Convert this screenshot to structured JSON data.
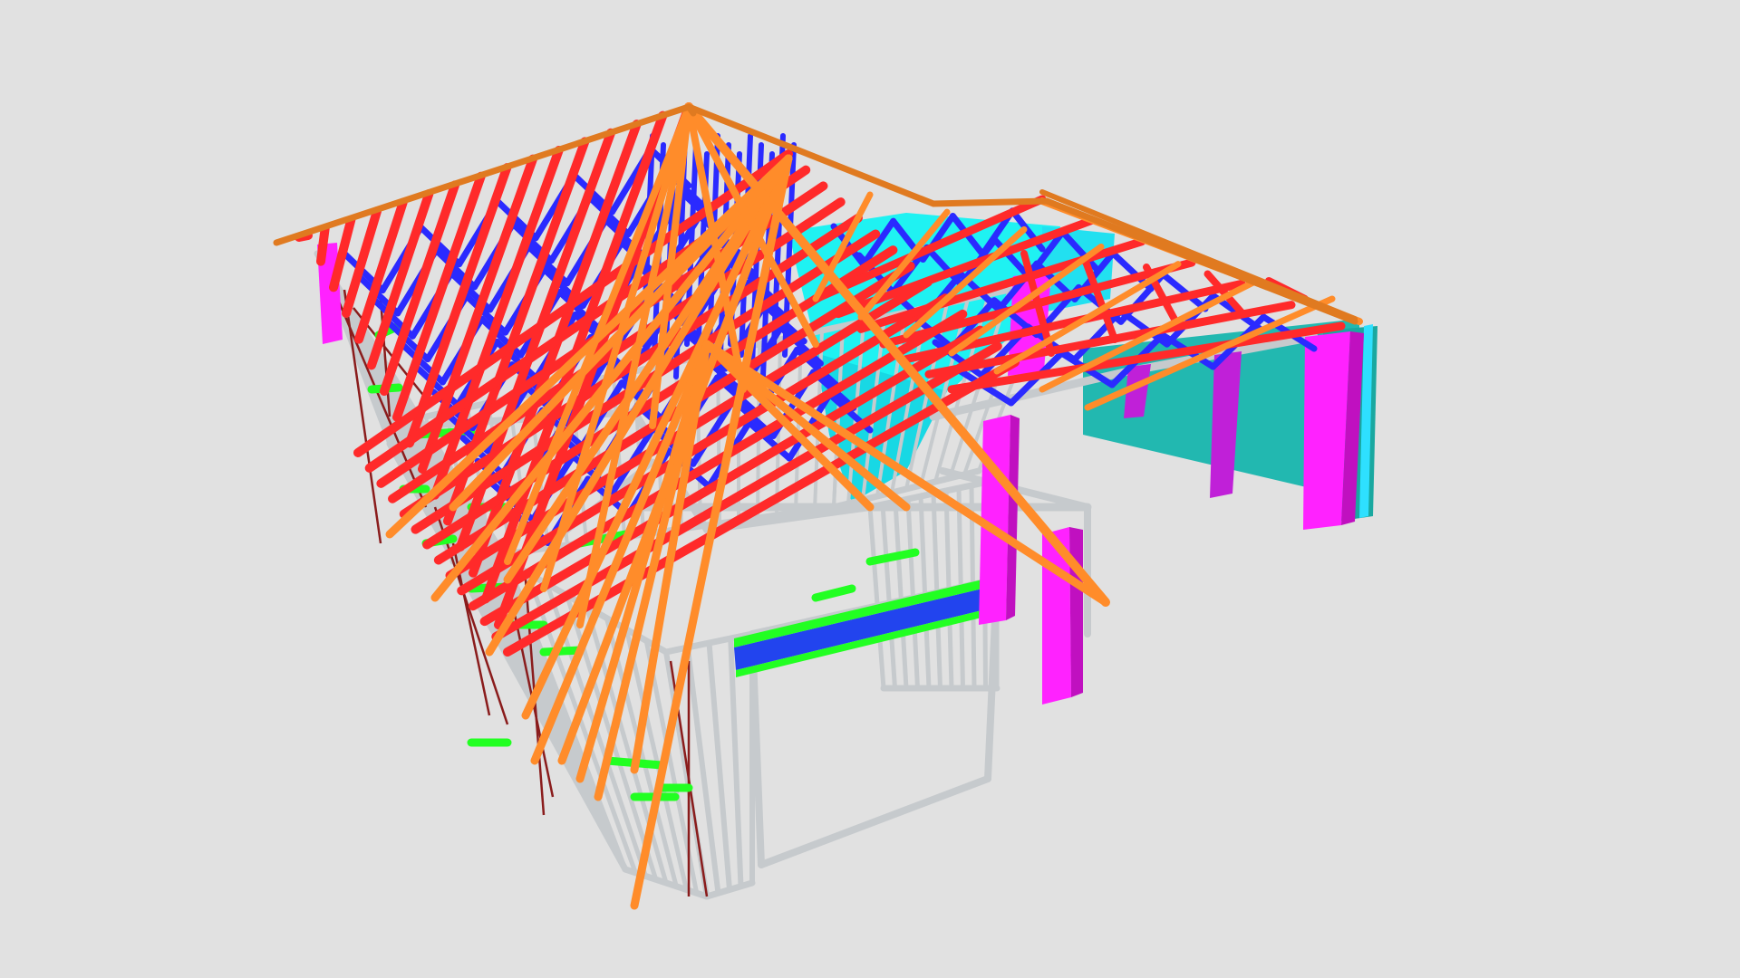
{
  "viewer": {
    "background": "#e1e1e1"
  },
  "palette": {
    "top_chord": "#ff2a2a",
    "web_member": "#2a2aff",
    "hip_rafter": "#ff8a2a",
    "ridge_fascia": "#e07a20",
    "wall_stud": "#c4c8cc",
    "nogging": "#2aff2a",
    "strap_brace": "#8a1c1c",
    "column": "#ff22ff",
    "cladding": "#22b8b0",
    "ceiling_panel": "#00ffff",
    "lintel": "#2244ee"
  },
  "model": {
    "description_hidden": "",
    "layers": [
      "wall-frames",
      "wall-bracing",
      "noggings",
      "trusses-top-chords",
      "trusses-webs",
      "hip-rafters",
      "ridge-fascia",
      "garage-columns",
      "garage-cladding",
      "ceiling-panels"
    ]
  }
}
